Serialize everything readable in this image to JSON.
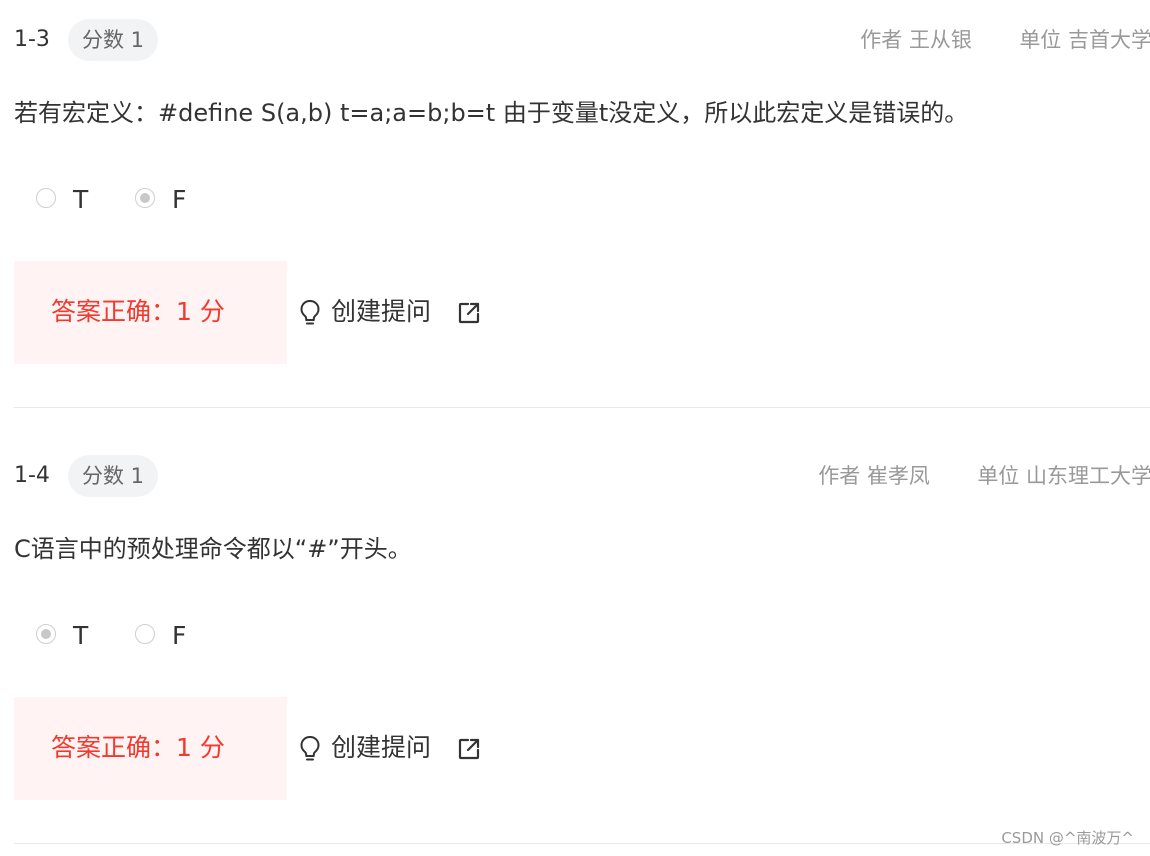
{
  "questions": [
    {
      "number": "1-3",
      "score": "分数 1",
      "author_label": "作者",
      "author": "王从银",
      "unit_label": "单位",
      "unit": "吉首大学",
      "text": "若有宏定义：#define S(a,b) t=a;a=b;b=t 由于变量t没定义，所以此宏定义是错误的。",
      "options": [
        {
          "label": "T",
          "selected": false
        },
        {
          "label": "F",
          "selected": true
        }
      ],
      "result": "答案正确：1 分",
      "ask": "创建提问"
    },
    {
      "number": "1-4",
      "score": "分数 1",
      "author_label": "作者",
      "author": "崔孝凤",
      "unit_label": "单位",
      "unit": "山东理工大学",
      "text": "C语言中的预处理命令都以“#”开头。",
      "options": [
        {
          "label": "T",
          "selected": true
        },
        {
          "label": "F",
          "selected": false
        }
      ],
      "result": "答案正确：1 分",
      "ask": "创建提问"
    }
  ],
  "icons": {
    "radio": "radio-icon",
    "bulb": "lightbulb-icon",
    "external": "external-link-icon"
  },
  "colors": {
    "correct_text": "#f5382e",
    "correct_bg": "#fff4f3",
    "meta_text": "#999999",
    "badge_bg": "#f2f3f5"
  },
  "watermark": "CSDN @^南波万^"
}
